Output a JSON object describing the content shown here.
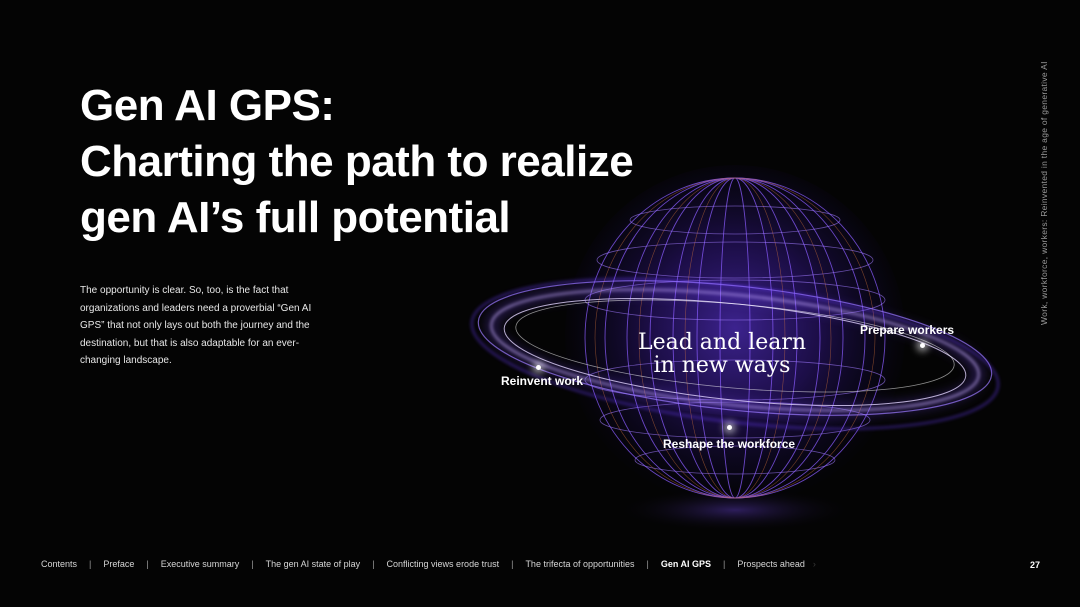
{
  "title_lines": [
    "Gen AI GPS:",
    "Charting the path to realize",
    "gen AI’s full potential"
  ],
  "intro": "The opportunity is clear. So, too, is the fact that organizations and leaders need a proverbial “Gen AI GPS” that not only lays out both the journey and the destination, but that is also adaptable for an ever-changing landscape.",
  "side_text": "Work, workforce, workers: Reinvented in the age of generative AI",
  "graphic": {
    "center_lines": [
      "Lead and learn",
      "in new ways"
    ],
    "nodes": {
      "reinvent": "Reinvent work",
      "prepare": "Prepare workers",
      "reshape": "Reshape the workforce"
    }
  },
  "nav": {
    "items": [
      "Contents",
      "Preface",
      "Executive summary",
      "The gen AI state of play",
      "Conflicting views erode trust",
      "The trifecta of opportunities",
      "Gen AI GPS",
      "Prospects ahead"
    ],
    "active": "Gen AI GPS",
    "separator": "|"
  },
  "page_number": "27",
  "colors": {
    "background": "#040404",
    "globe_primary": "#7a4dff",
    "globe_glow": "#b48cff",
    "accent_orange": "#ff8a3d"
  }
}
